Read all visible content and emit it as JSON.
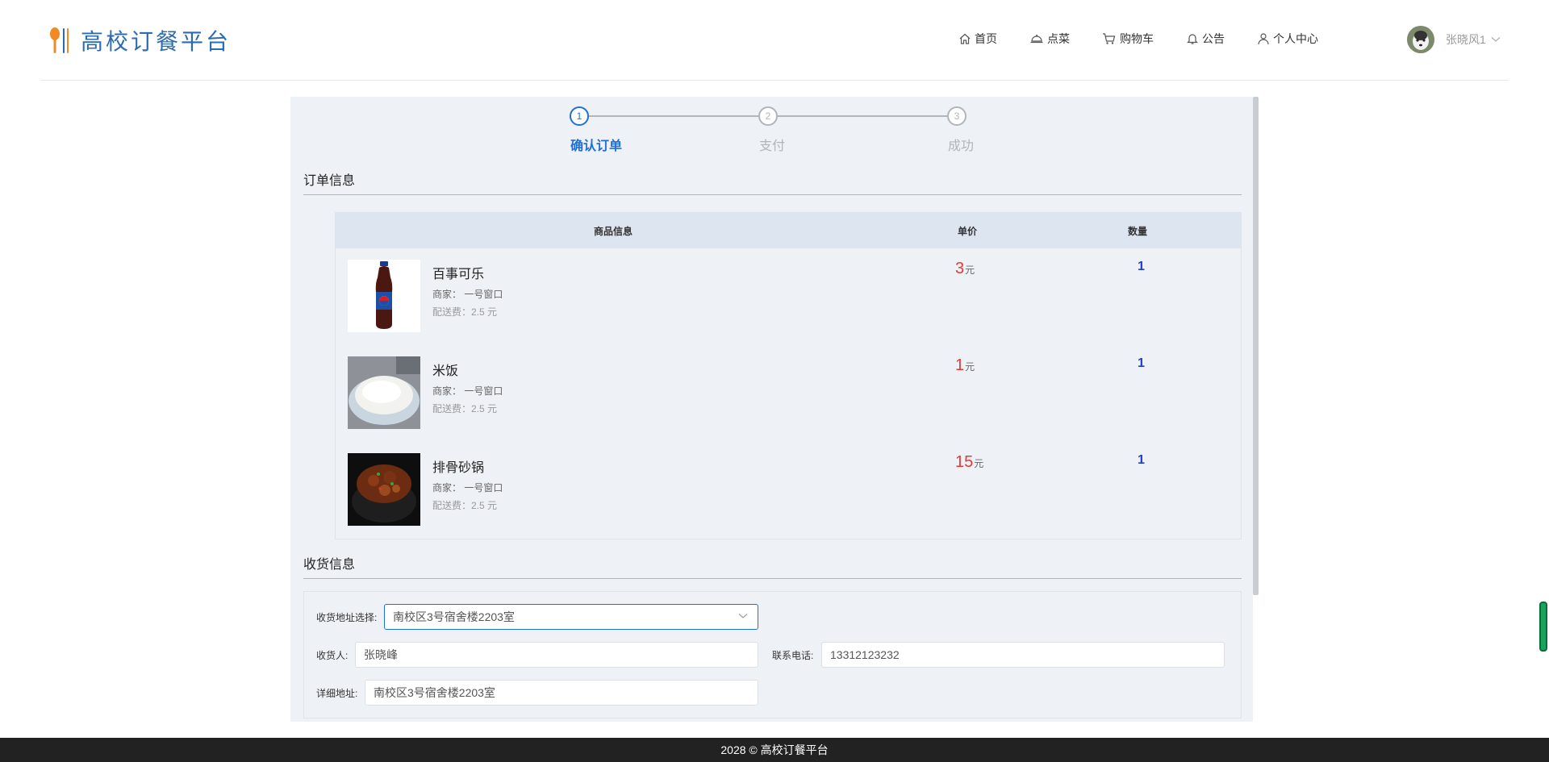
{
  "brand": {
    "title": "高校订餐平台"
  },
  "nav": {
    "items": [
      {
        "label": "首页",
        "icon": "home-icon"
      },
      {
        "label": "点菜",
        "icon": "dish-icon"
      },
      {
        "label": "购物车",
        "icon": "cart-icon"
      },
      {
        "label": "公告",
        "icon": "bell-icon"
      },
      {
        "label": "个人中心",
        "icon": "user-icon"
      }
    ]
  },
  "user": {
    "name": "张晓风1"
  },
  "steps": [
    {
      "num": "1",
      "label": "确认订单",
      "active": true
    },
    {
      "num": "2",
      "label": "支付",
      "active": false
    },
    {
      "num": "3",
      "label": "成功",
      "active": false
    }
  ],
  "order": {
    "title": "订单信息",
    "headers": {
      "info": "商品信息",
      "price": "单价",
      "qty": "数量"
    },
    "items": [
      {
        "name": "百事可乐",
        "shop": "商家：  一号窗口",
        "fee": "配送费：2.5 元",
        "price": "3",
        "unit": "元",
        "qty": "1"
      },
      {
        "name": "米饭",
        "shop": "商家：  一号窗口",
        "fee": "配送费：2.5 元",
        "price": "1",
        "unit": "元",
        "qty": "1"
      },
      {
        "name": "排骨砂锅",
        "shop": "商家：  一号窗口",
        "fee": "配送费：2.5 元",
        "price": "15",
        "unit": "元",
        "qty": "1"
      }
    ]
  },
  "delivery": {
    "title": "收货信息",
    "address_select_label": "收货地址选择:",
    "address_select_value": "南校区3号宿舍楼2203室",
    "receiver_label": "收货人:",
    "receiver_value": "张晓峰",
    "phone_label": "联系电话:",
    "phone_value": "13312123232",
    "detail_label": "详细地址:",
    "detail_value": "南校区3号宿舍楼2203室"
  },
  "footer": {
    "text": "2028 © 高校订餐平台"
  },
  "colors": {
    "accent": "#1f6fd8",
    "price": "#e53935",
    "footer_bg": "#222222"
  }
}
